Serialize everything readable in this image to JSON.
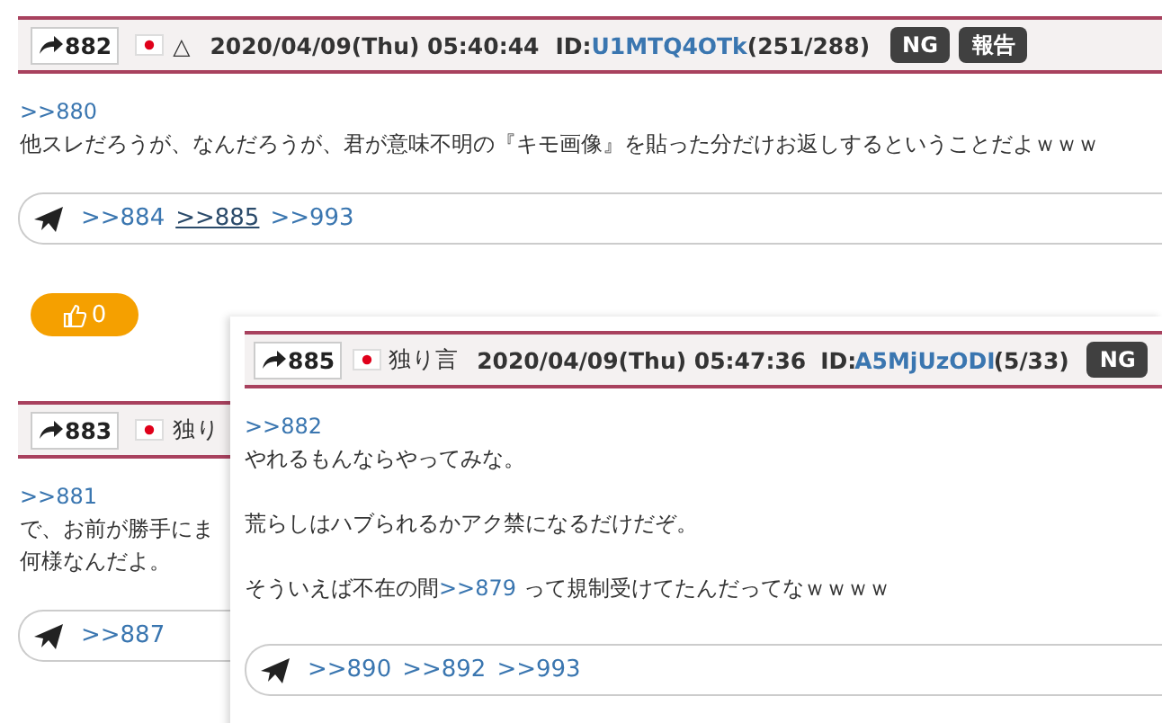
{
  "posts": [
    {
      "number": "882",
      "name": "△",
      "date": "2020/04/09(Thu) 05:40:44",
      "id_label": "ID:",
      "id": "U1MTQ4OTk",
      "count": "(251/288)",
      "buttons": [
        "NG",
        "報告"
      ],
      "blocks": [
        [
          [
            {
              "kind": "link",
              "text": ">>880"
            }
          ],
          [
            {
              "kind": "text",
              "text": "他スレだろうが、なんだろうが、君が意味不明の『キモ画像』を貼った分だけお返しするということだよｗｗｗ"
            }
          ]
        ]
      ],
      "replies": [
        {
          "text": ">>884",
          "hover": false
        },
        {
          "text": ">>885",
          "hover": true
        },
        {
          "text": ">>993",
          "hover": false
        }
      ],
      "like": "0"
    },
    {
      "number": "883",
      "name": "独り",
      "blocks": [
        [
          [
            {
              "kind": "link",
              "text": ">>881"
            }
          ],
          [
            {
              "kind": "text",
              "text": "で、お前が勝手にま"
            }
          ],
          [
            {
              "kind": "text",
              "text": "何様なんだよ。"
            }
          ]
        ]
      ],
      "replies": [
        {
          "text": ">>887",
          "hover": false
        }
      ]
    }
  ],
  "popup": {
    "number": "885",
    "name": "独り言",
    "date": "2020/04/09(Thu) 05:47:36",
    "id_label": "ID:",
    "id": "A5MjUzODI",
    "count": "(5/33)",
    "buttons": [
      "NG"
    ],
    "blocks": [
      [
        [
          {
            "kind": "link",
            "text": ">>882"
          }
        ],
        [
          {
            "kind": "text",
            "text": "やれるもんならやってみな。"
          }
        ]
      ],
      [
        [
          {
            "kind": "text",
            "text": "荒らしはハブられるかアク禁になるだけだぞ。"
          }
        ]
      ],
      [
        [
          {
            "kind": "text",
            "text": "そういえば不在の間"
          },
          {
            "kind": "link",
            "text": ">>879"
          },
          {
            "kind": "text",
            "text": " って規制受けてたんだってなｗｗｗｗ"
          }
        ]
      ]
    ],
    "replies": [
      {
        "text": ">>890",
        "hover": false
      },
      {
        "text": ">>892",
        "hover": false
      },
      {
        "text": ">>993",
        "hover": false
      }
    ]
  }
}
